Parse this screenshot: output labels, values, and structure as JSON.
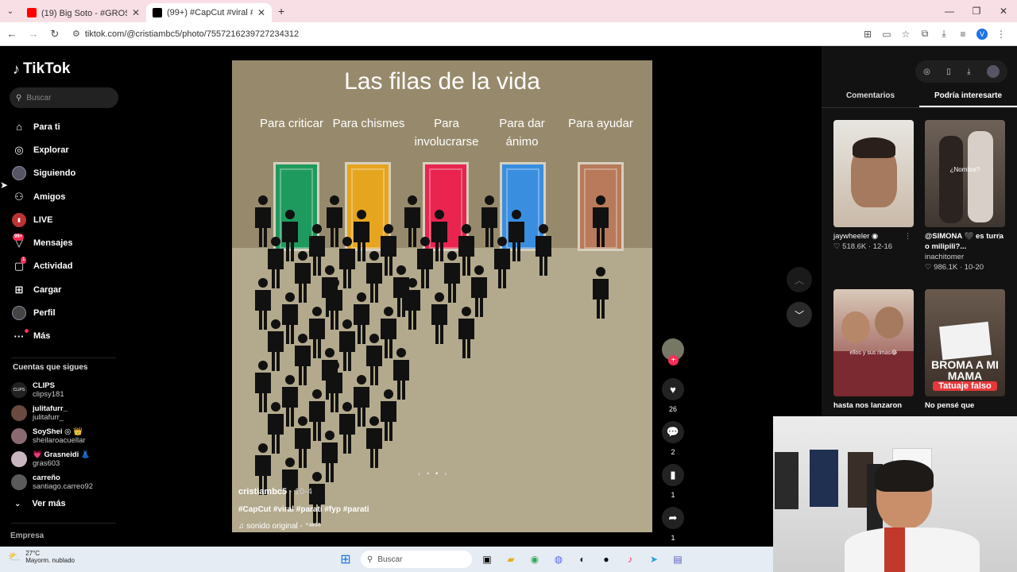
{
  "browser": {
    "tabs": [
      {
        "title": "(19) Big Soto - #GROSERO 😬 |",
        "favicon_color": "#ff0000",
        "active": false
      },
      {
        "title": "(99+) #CapCut #viral #parati #fy",
        "favicon_color": "#000000",
        "active": true
      }
    ],
    "new_tab": "+",
    "url": "tiktok.com/@cristiambc5/photo/7557216239727234312",
    "window_controls": [
      "—",
      "❐",
      "✕"
    ],
    "profile_initial": "V"
  },
  "tiktok": {
    "logo": "TikTok",
    "search_placeholder": "Buscar",
    "nav": [
      {
        "label": "Para ti",
        "icon": "home-icon"
      },
      {
        "label": "Explorar",
        "icon": "compass-icon"
      },
      {
        "label": "Siguiendo",
        "icon": "following-avatar-icon"
      },
      {
        "label": "Amigos",
        "icon": "friends-icon"
      },
      {
        "label": "LIVE",
        "icon": "live-icon"
      },
      {
        "label": "Mensajes",
        "icon": "messages-icon",
        "badge": "99+"
      },
      {
        "label": "Actividad",
        "icon": "activity-icon",
        "badge": "1"
      },
      {
        "label": "Cargar",
        "icon": "upload-icon"
      },
      {
        "label": "Perfil",
        "icon": "profile-icon"
      },
      {
        "label": "Más",
        "icon": "more-icon"
      }
    ],
    "following_title": "Cuentas que sigues",
    "following": [
      {
        "name": "CLIPS",
        "user": "clipsy181",
        "avatar": "CLIPS"
      },
      {
        "name": "julitafurr_",
        "user": "julitafurr_",
        "avatar": ""
      },
      {
        "name": "SoyShei ◎ 👑",
        "user": "sheilaroacuellar",
        "avatar": ""
      },
      {
        "name": "💗 Grasneidi 👗",
        "user": "gras603",
        "avatar": ""
      },
      {
        "name": "carreño",
        "user": "santiago.carreo92",
        "avatar": ""
      }
    ],
    "ver_mas": "Ver más",
    "empresa": "Empresa"
  },
  "post": {
    "image_title": "Las filas de la vida",
    "columns": [
      {
        "label": "Para criticar",
        "door_color": "#1f9a5e"
      },
      {
        "label": "Para chismes",
        "door_color": "#e6a51f"
      },
      {
        "label": "Para involucrarse",
        "door_color": "#e8244f"
      },
      {
        "label": "Para dar ánimo",
        "door_color": "#3a8ee0"
      },
      {
        "label": "Para ayudar",
        "door_color": "#b87a5a"
      }
    ],
    "people_per_column": [
      21,
      17,
      9,
      4,
      2
    ],
    "author": "cristiambc5",
    "date": " · 10-4",
    "hashtags": "#CapCut #viral #parati #fyp #parati",
    "sound": "sonido original - ⁺ᵃᵉ¹⁶",
    "slide_nav": [
      "‹",
      "•",
      "•",
      "›"
    ]
  },
  "actions": {
    "likes": "26",
    "comments": "2",
    "saves": "1",
    "shares": "1"
  },
  "right_panel": {
    "tabs": [
      "Comentarios",
      "Podría interesarte"
    ],
    "active_tab": 1,
    "cards": [
      {
        "title": "jaywheeler ◉",
        "author": "",
        "meta": "♡ 518.6K · 12-16",
        "thumb_color": "#cfc7bb",
        "overlay": ""
      },
      {
        "title": "@SIMONA 🖤 es turra o milipili?...",
        "author": "inachitomer",
        "meta": "♡ 986.1K · 10-20",
        "thumb_color": "#7a6a5e",
        "overlay": "¿Nombre?"
      },
      {
        "title": "hasta nos lanzaron",
        "author": "",
        "meta": "",
        "thumb_color": "#8a5a4a",
        "overlay": "ellos y sus rimas😂"
      },
      {
        "title": "No pensé que",
        "author": "",
        "meta": "",
        "thumb_color": "#6e5a4c",
        "overlay": "BROMA A MI MAMA"
      }
    ],
    "card4_subtitle": "Tatuaje falso"
  },
  "taskbar": {
    "temp": "27°C",
    "weather": "Mayorm. nublado",
    "search": "Buscar"
  }
}
